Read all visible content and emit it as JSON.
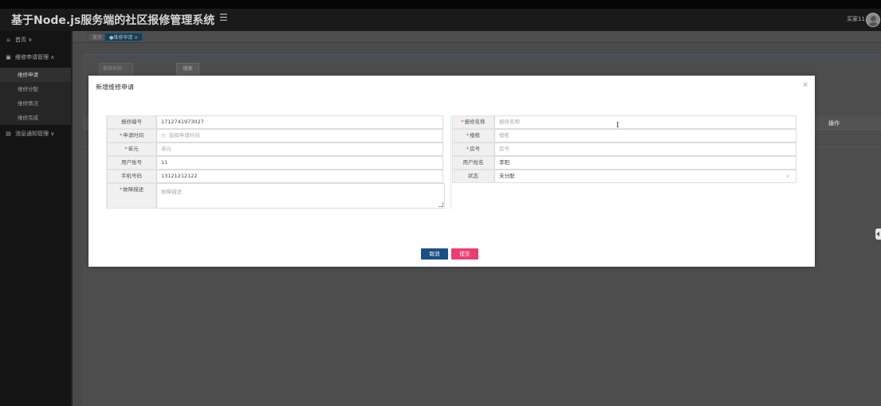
{
  "header": {
    "title": "基于Node.js服务端的社区报修管理系统",
    "menu_icon": "☰",
    "user_label": "买家11"
  },
  "sidebar": {
    "items": [
      {
        "icon": "home-icon",
        "glyph": "⌂",
        "label": "首页 ∨"
      },
      {
        "icon": "repair-icon",
        "glyph": "▣",
        "label": "维修申请管理 ∧"
      },
      {
        "icon": "info-icon",
        "glyph": "▤",
        "label": "消息通知管理 ∨"
      }
    ],
    "subitems": [
      "维修申请",
      "维修分配",
      "维修情况",
      "维修完成"
    ]
  },
  "tabs": [
    {
      "label": "首页"
    },
    {
      "label": "●维修申请 ×"
    }
  ],
  "background": {
    "search_placeholder": "报修名称",
    "search_button": "搜索",
    "table_op_header": "操作"
  },
  "dialog": {
    "title": "新增维修申请",
    "close": "×",
    "fields_left": [
      {
        "label": "报修编号",
        "required": false,
        "value": "1712741973027",
        "placeholder": false
      },
      {
        "label": "申请时间",
        "required": true,
        "value": "选择申请时间",
        "placeholder": true,
        "icon": "clock-icon"
      },
      {
        "label": "单元",
        "required": true,
        "value": "单元",
        "placeholder": true
      },
      {
        "label": "用户账号",
        "required": false,
        "value": "11",
        "placeholder": false
      },
      {
        "label": "手机号码",
        "required": false,
        "value": "13121212122",
        "placeholder": false
      },
      {
        "label": "故障描述",
        "required": true,
        "value": "故障描述",
        "placeholder": true
      }
    ],
    "fields_right": [
      {
        "label": "报修名称",
        "required": true,
        "value": "报修名称",
        "placeholder": true
      },
      {
        "label": "楼栋",
        "required": true,
        "value": "楼栋",
        "placeholder": true
      },
      {
        "label": "房号",
        "required": true,
        "value": "房号",
        "placeholder": true
      },
      {
        "label": "用户姓名",
        "required": false,
        "value": "李阳",
        "placeholder": false
      },
      {
        "label": "状态",
        "required": false,
        "value": "未分配",
        "placeholder": false,
        "select": true
      }
    ],
    "cancel_label": "取消",
    "submit_label": "提交"
  }
}
